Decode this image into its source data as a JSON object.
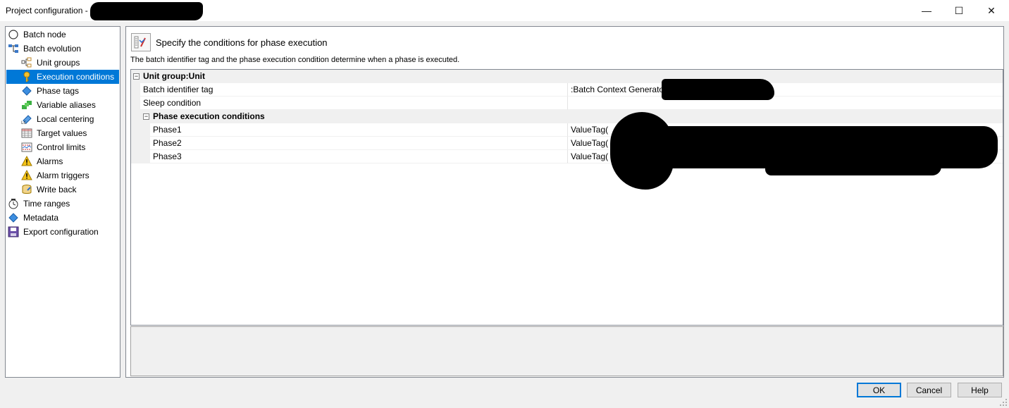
{
  "window": {
    "title": "Project configuration -",
    "minimize_glyph": "—",
    "maximize_glyph": "☐",
    "close_glyph": "✕"
  },
  "tree": {
    "items": [
      {
        "label": "Batch node",
        "icon": "circle-node-icon"
      },
      {
        "label": "Batch evolution",
        "icon": "hierarchy-icon"
      },
      {
        "label": "Unit groups",
        "icon": "unit-groups-icon"
      },
      {
        "label": "Execution conditions",
        "icon": "key-icon",
        "selected": true
      },
      {
        "label": "Phase tags",
        "icon": "diamond-tag-icon"
      },
      {
        "label": "Variable aliases",
        "icon": "green-blocks-icon"
      },
      {
        "label": "Local centering",
        "icon": "local-centering-icon"
      },
      {
        "label": "Target values",
        "icon": "table-grid-icon"
      },
      {
        "label": "Control limits",
        "icon": "chart-limits-icon"
      },
      {
        "label": "Alarms",
        "icon": "warning-icon"
      },
      {
        "label": "Alarm triggers",
        "icon": "warning-icon"
      },
      {
        "label": "Write back",
        "icon": "database-write-icon"
      },
      {
        "label": "Time ranges",
        "icon": "clock-icon"
      },
      {
        "label": "Metadata",
        "icon": "diamond-tag-icon"
      },
      {
        "label": "Export configuration",
        "icon": "floppy-disk-icon"
      }
    ]
  },
  "panel": {
    "title": "Specify the conditions for phase execution",
    "description": "The batch identifier tag and the phase execution condition determine when a phase is executed."
  },
  "grid": {
    "category": "Unit group:Unit",
    "rows": [
      {
        "label": "Batch identifier tag",
        "value": ":Batch Context Generator"
      },
      {
        "label": "Sleep condition",
        "value": ""
      }
    ],
    "subcategory": "Phase execution conditions",
    "phases": [
      {
        "label": "Phase1",
        "value": "ValueTag("
      },
      {
        "label": "Phase2",
        "value": "ValueTag("
      },
      {
        "label": "Phase3",
        "value": "ValueTag("
      }
    ],
    "toggle_glyph": "−"
  },
  "buttons": {
    "ok": "OK",
    "cancel": "Cancel",
    "help": "Help"
  }
}
